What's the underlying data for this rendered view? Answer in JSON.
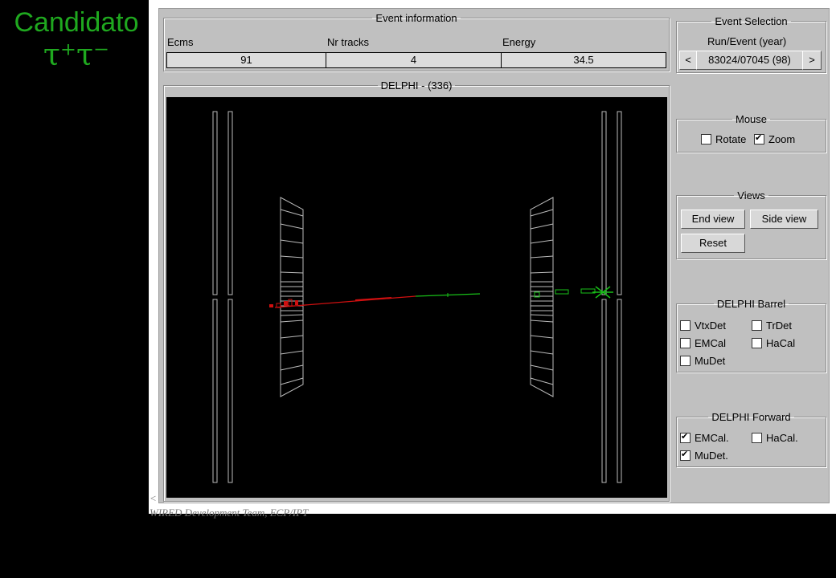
{
  "slide": {
    "title_line1": "Candidato",
    "title_line2": "τ⁺τ⁻"
  },
  "footer": {
    "line1": "<",
    "line2": "WIRED Development Team, ECP/IPT"
  },
  "event_info": {
    "legend": "Event information",
    "columns": [
      "Ecms",
      "Nr tracks",
      "Energy"
    ],
    "values": [
      "91",
      "4",
      "34.5"
    ]
  },
  "display": {
    "legend": "DELPHI - (336)"
  },
  "event_selection": {
    "legend": "Event Selection",
    "header": "Run/Event   (year)",
    "prev": "<",
    "value": "83024/07045   (98)",
    "next": ">"
  },
  "mouse": {
    "legend": "Mouse",
    "options": [
      {
        "label": "Rotate",
        "checked": false
      },
      {
        "label": "Zoom",
        "checked": true
      }
    ]
  },
  "views": {
    "legend": "Views",
    "end_view": "End view",
    "side_view": "Side view",
    "reset": "Reset"
  },
  "barrel": {
    "legend": "DELPHI Barrel",
    "options": [
      {
        "label": "VtxDet",
        "checked": false
      },
      {
        "label": "TrDet",
        "checked": false
      },
      {
        "label": "EMCal",
        "checked": false
      },
      {
        "label": "HaCal",
        "checked": false
      },
      {
        "label": "MuDet",
        "checked": false
      }
    ]
  },
  "forward": {
    "legend": "DELPHI Forward",
    "options": [
      {
        "label": "EMCal.",
        "checked": true
      },
      {
        "label": "HaCal.",
        "checked": false
      },
      {
        "label": "MuDet.",
        "checked": true
      }
    ]
  },
  "colors": {
    "title": "#1fa81f",
    "panel": "#c0c0c0",
    "track_red": "#d01010",
    "track_green": "#18c018"
  }
}
